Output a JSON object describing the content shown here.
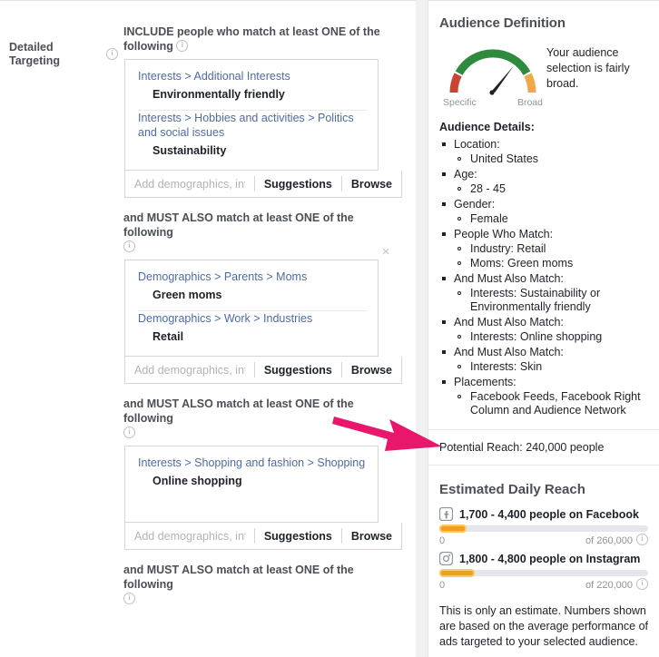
{
  "form": {
    "field_label": "Detailed Targeting",
    "include_heading": "INCLUDE people who match at least ONE of the following",
    "and_heading": "and MUST ALSO match at least ONE of the following",
    "input_placeholder": "Add demographics, int...",
    "suggestions_label": "Suggestions",
    "browse_label": "Browse",
    "close_label": "×",
    "info_glyph": "i",
    "groups": [
      {
        "specs": [
          {
            "path": "Interests > Additional Interests",
            "value": "Environmentally friendly"
          },
          {
            "path": "Interests > Hobbies and activities > Politics and social issues",
            "value": "Sustainability"
          }
        ]
      },
      {
        "specs": [
          {
            "path": "Demographics > Parents > Moms",
            "value": "Green moms"
          },
          {
            "path": "Demographics > Work > Industries",
            "value": "Retail"
          }
        ]
      },
      {
        "specs": [
          {
            "path": "Interests > Shopping and fashion > Shopping",
            "value": "Online shopping"
          }
        ]
      }
    ]
  },
  "audience": {
    "title": "Audience Definition",
    "gauge": {
      "specific_label": "Specific",
      "broad_label": "Broad",
      "description": "Your audience selection is fairly broad.",
      "needle_angle_deg": 48,
      "colors": {
        "low": "#d9534f",
        "mid": "#2e8b3d",
        "high": "#f0a84a",
        "needle": "#1d2129"
      }
    },
    "details_title": "Audience Details:",
    "details": [
      {
        "label": "Location:",
        "sub": [
          "United States"
        ]
      },
      {
        "label": "Age:",
        "sub": [
          "28 - 45"
        ]
      },
      {
        "label": "Gender:",
        "sub": [
          "Female"
        ]
      },
      {
        "label": "People Who Match:",
        "sub": [
          "Industry: Retail",
          "Moms: Green moms"
        ]
      },
      {
        "label": "And Must Also Match:",
        "sub": [
          "Interests: Sustainability or Environmentally friendly"
        ]
      },
      {
        "label": "And Must Also Match:",
        "sub": [
          "Interests: Online shopping"
        ]
      },
      {
        "label": "And Must Also Match:",
        "sub": [
          "Interests: Skin"
        ]
      },
      {
        "label": "Placements:",
        "sub": [
          "Facebook Feeds, Facebook Right Column and Audience Network"
        ]
      }
    ],
    "potential_reach": "Potential Reach: 240,000 people",
    "estimated_title": "Estimated Daily Reach",
    "reach": [
      {
        "icon": "facebook-icon",
        "text": "1,700 - 4,400 people on Facebook",
        "axis_min": "0",
        "axis_max": "of 260,000",
        "fill_percent": 13
      },
      {
        "icon": "instagram-icon",
        "text": "1,800 - 4,800 people on Instagram",
        "axis_min": "0",
        "axis_max": "of 220,000",
        "fill_percent": 17
      }
    ],
    "estimate_note": "This is only an estimate. Numbers shown are based on the average performance of ads targeted to your selected audience."
  },
  "annotation": {
    "arrow_color": "#e8176b"
  }
}
